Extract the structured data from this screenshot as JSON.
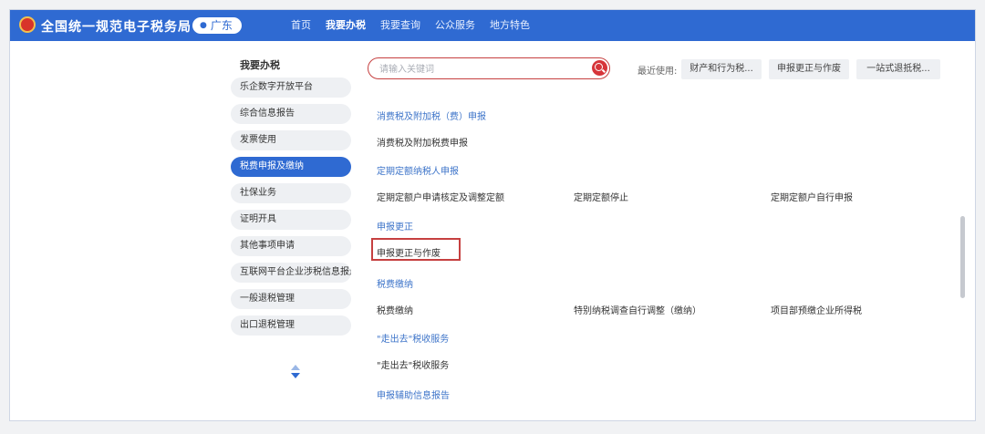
{
  "header": {
    "brand": "全国统一规范电子税务局",
    "region": "广东",
    "nav": [
      "首页",
      "我要办税",
      "我要查询",
      "公众服务",
      "地方特色"
    ],
    "active_nav": 1
  },
  "sidebar": {
    "title": "我要办税",
    "items": [
      {
        "label": "乐企数字开放平台"
      },
      {
        "label": "综合信息报告"
      },
      {
        "label": "发票使用"
      },
      {
        "label": "税费申报及缴纳"
      },
      {
        "label": "社保业务"
      },
      {
        "label": "证明开具"
      },
      {
        "label": "其他事项申请"
      },
      {
        "label": "互联网平台企业涉税信息报送"
      },
      {
        "label": "一般退税管理"
      },
      {
        "label": "出口退税管理"
      }
    ],
    "active_index": 3
  },
  "search": {
    "placeholder": "请输入关键词",
    "recent_label": "最近使用:",
    "recent": [
      "财产和行为税...",
      "申报更正与作废",
      "一站式退抵税..."
    ]
  },
  "sections": [
    {
      "title": "消费税及附加税（费）申报",
      "items": [
        "消费税及附加税费申报"
      ]
    },
    {
      "title": "定期定额纳税人申报",
      "items": [
        "定期定额户申请核定及调整定额",
        "定期定额停止",
        "定期定额户自行申报"
      ]
    },
    {
      "title": "申报更正",
      "items": [
        "申报更正与作废"
      ]
    },
    {
      "title": "税费缴纳",
      "items": [
        "税费缴纳",
        "特别纳税调查自行调整（缴纳）",
        "项目部预缴企业所得税"
      ]
    },
    {
      "title": "\"走出去\"税收服务",
      "items": [
        "\"走出去\"税收服务"
      ]
    },
    {
      "title": "申报辅助信息报告",
      "items": []
    }
  ],
  "colors": {
    "primary": "#2f6ad2",
    "highlight": "#c64040",
    "section_title": "#3d74c9"
  }
}
